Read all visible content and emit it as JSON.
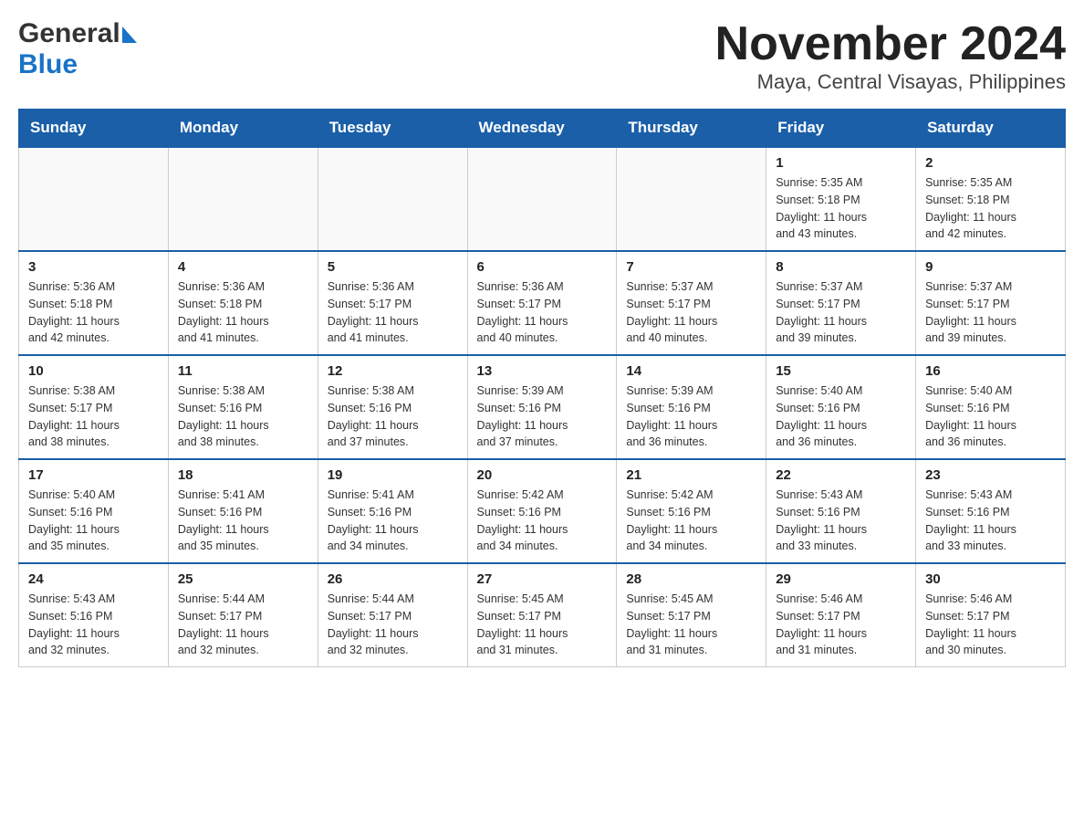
{
  "header": {
    "logo_general": "General",
    "logo_blue": "Blue",
    "title": "November 2024",
    "subtitle": "Maya, Central Visayas, Philippines"
  },
  "calendar": {
    "days_of_week": [
      "Sunday",
      "Monday",
      "Tuesday",
      "Wednesday",
      "Thursday",
      "Friday",
      "Saturday"
    ],
    "weeks": [
      [
        {
          "date": "",
          "info": ""
        },
        {
          "date": "",
          "info": ""
        },
        {
          "date": "",
          "info": ""
        },
        {
          "date": "",
          "info": ""
        },
        {
          "date": "",
          "info": ""
        },
        {
          "date": "1",
          "info": "Sunrise: 5:35 AM\nSunset: 5:18 PM\nDaylight: 11 hours\nand 43 minutes."
        },
        {
          "date": "2",
          "info": "Sunrise: 5:35 AM\nSunset: 5:18 PM\nDaylight: 11 hours\nand 42 minutes."
        }
      ],
      [
        {
          "date": "3",
          "info": "Sunrise: 5:36 AM\nSunset: 5:18 PM\nDaylight: 11 hours\nand 42 minutes."
        },
        {
          "date": "4",
          "info": "Sunrise: 5:36 AM\nSunset: 5:18 PM\nDaylight: 11 hours\nand 41 minutes."
        },
        {
          "date": "5",
          "info": "Sunrise: 5:36 AM\nSunset: 5:17 PM\nDaylight: 11 hours\nand 41 minutes."
        },
        {
          "date": "6",
          "info": "Sunrise: 5:36 AM\nSunset: 5:17 PM\nDaylight: 11 hours\nand 40 minutes."
        },
        {
          "date": "7",
          "info": "Sunrise: 5:37 AM\nSunset: 5:17 PM\nDaylight: 11 hours\nand 40 minutes."
        },
        {
          "date": "8",
          "info": "Sunrise: 5:37 AM\nSunset: 5:17 PM\nDaylight: 11 hours\nand 39 minutes."
        },
        {
          "date": "9",
          "info": "Sunrise: 5:37 AM\nSunset: 5:17 PM\nDaylight: 11 hours\nand 39 minutes."
        }
      ],
      [
        {
          "date": "10",
          "info": "Sunrise: 5:38 AM\nSunset: 5:17 PM\nDaylight: 11 hours\nand 38 minutes."
        },
        {
          "date": "11",
          "info": "Sunrise: 5:38 AM\nSunset: 5:16 PM\nDaylight: 11 hours\nand 38 minutes."
        },
        {
          "date": "12",
          "info": "Sunrise: 5:38 AM\nSunset: 5:16 PM\nDaylight: 11 hours\nand 37 minutes."
        },
        {
          "date": "13",
          "info": "Sunrise: 5:39 AM\nSunset: 5:16 PM\nDaylight: 11 hours\nand 37 minutes."
        },
        {
          "date": "14",
          "info": "Sunrise: 5:39 AM\nSunset: 5:16 PM\nDaylight: 11 hours\nand 36 minutes."
        },
        {
          "date": "15",
          "info": "Sunrise: 5:40 AM\nSunset: 5:16 PM\nDaylight: 11 hours\nand 36 minutes."
        },
        {
          "date": "16",
          "info": "Sunrise: 5:40 AM\nSunset: 5:16 PM\nDaylight: 11 hours\nand 36 minutes."
        }
      ],
      [
        {
          "date": "17",
          "info": "Sunrise: 5:40 AM\nSunset: 5:16 PM\nDaylight: 11 hours\nand 35 minutes."
        },
        {
          "date": "18",
          "info": "Sunrise: 5:41 AM\nSunset: 5:16 PM\nDaylight: 11 hours\nand 35 minutes."
        },
        {
          "date": "19",
          "info": "Sunrise: 5:41 AM\nSunset: 5:16 PM\nDaylight: 11 hours\nand 34 minutes."
        },
        {
          "date": "20",
          "info": "Sunrise: 5:42 AM\nSunset: 5:16 PM\nDaylight: 11 hours\nand 34 minutes."
        },
        {
          "date": "21",
          "info": "Sunrise: 5:42 AM\nSunset: 5:16 PM\nDaylight: 11 hours\nand 34 minutes."
        },
        {
          "date": "22",
          "info": "Sunrise: 5:43 AM\nSunset: 5:16 PM\nDaylight: 11 hours\nand 33 minutes."
        },
        {
          "date": "23",
          "info": "Sunrise: 5:43 AM\nSunset: 5:16 PM\nDaylight: 11 hours\nand 33 minutes."
        }
      ],
      [
        {
          "date": "24",
          "info": "Sunrise: 5:43 AM\nSunset: 5:16 PM\nDaylight: 11 hours\nand 32 minutes."
        },
        {
          "date": "25",
          "info": "Sunrise: 5:44 AM\nSunset: 5:17 PM\nDaylight: 11 hours\nand 32 minutes."
        },
        {
          "date": "26",
          "info": "Sunrise: 5:44 AM\nSunset: 5:17 PM\nDaylight: 11 hours\nand 32 minutes."
        },
        {
          "date": "27",
          "info": "Sunrise: 5:45 AM\nSunset: 5:17 PM\nDaylight: 11 hours\nand 31 minutes."
        },
        {
          "date": "28",
          "info": "Sunrise: 5:45 AM\nSunset: 5:17 PM\nDaylight: 11 hours\nand 31 minutes."
        },
        {
          "date": "29",
          "info": "Sunrise: 5:46 AM\nSunset: 5:17 PM\nDaylight: 11 hours\nand 31 minutes."
        },
        {
          "date": "30",
          "info": "Sunrise: 5:46 AM\nSunset: 5:17 PM\nDaylight: 11 hours\nand 30 minutes."
        }
      ]
    ]
  }
}
